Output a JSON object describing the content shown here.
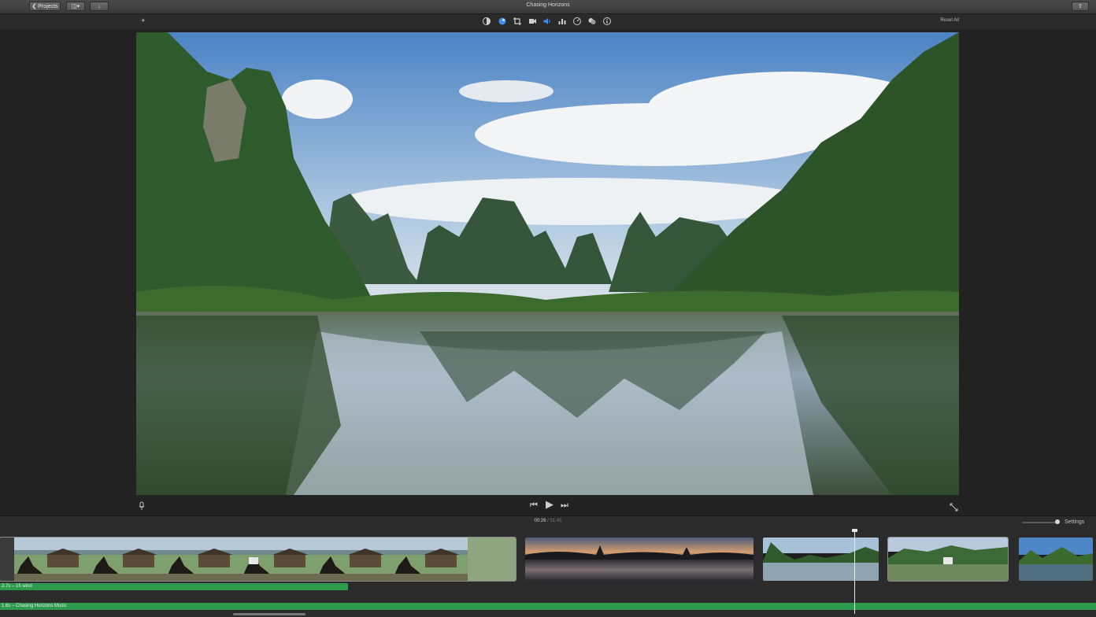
{
  "window": {
    "title": "Chasing Horizons",
    "projects_button": "Projects"
  },
  "toolbar": {
    "tools": [
      "color-balance-icon",
      "color-correction-icon",
      "crop-icon",
      "stabilization-icon",
      "volume-icon",
      "noise-reduction-icon",
      "speed-icon",
      "clip-filter-icon",
      "info-icon"
    ],
    "reset_all": "Reset All"
  },
  "player": {
    "timecode_current": "00:26",
    "timecode_separator": "/",
    "timecode_total": "01:41"
  },
  "timeline": {
    "settings_label": "Settings",
    "clip_audio_label": "2.7s – 15 wind",
    "music_label": "1.6s – Chasing Horizons Music"
  },
  "colors": {
    "accent": "#3c8ee8",
    "audio_green": "#2e9a4e",
    "background": "#222223"
  }
}
